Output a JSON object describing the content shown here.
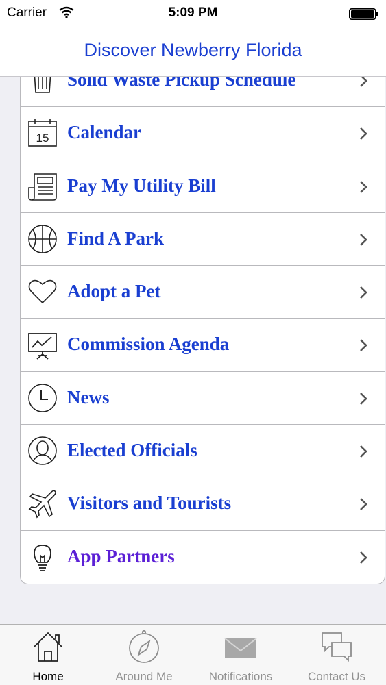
{
  "status_bar": {
    "carrier": "Carrier",
    "time": "5:09 PM"
  },
  "nav": {
    "title": "Discover Newberry Florida"
  },
  "menu": {
    "items": [
      {
        "label": "Solid Waste Pickup Schedule",
        "icon": "trash-icon"
      },
      {
        "label": "Calendar",
        "icon": "calendar-icon",
        "calendar_day": "15"
      },
      {
        "label": "Pay My Utility Bill",
        "icon": "bill-icon"
      },
      {
        "label": "Find A Park",
        "icon": "basketball-icon"
      },
      {
        "label": "Adopt a Pet",
        "icon": "heart-icon"
      },
      {
        "label": "Commission Agenda",
        "icon": "presentation-icon"
      },
      {
        "label": "News",
        "icon": "clock-icon"
      },
      {
        "label": "Elected Officials",
        "icon": "person-icon"
      },
      {
        "label": "Visitors and Tourists",
        "icon": "airplane-icon"
      },
      {
        "label": "App Partners",
        "icon": "lightbulb-icon"
      }
    ]
  },
  "tabs": [
    {
      "label": "Home",
      "icon": "home-icon",
      "active": true
    },
    {
      "label": "Around Me",
      "icon": "compass-icon",
      "active": false
    },
    {
      "label": "Notifications",
      "icon": "envelope-icon",
      "active": false
    },
    {
      "label": "Contact Us",
      "icon": "chat-bubbles-icon",
      "active": false
    }
  ],
  "colors": {
    "link_text": "#1a3fd1",
    "visited_link_text": "#5b1fd6",
    "title_text": "#1b3fd1",
    "active_tab": "#000000",
    "inactive_tab": "#929292"
  }
}
